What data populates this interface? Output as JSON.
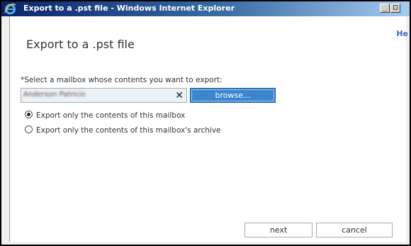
{
  "window": {
    "title": "Export to a .pst file - Windows Internet Explorer",
    "minimize_glyph": "_",
    "maximize_glyph": "□"
  },
  "header": {
    "help_link": "He"
  },
  "page": {
    "title": "Export to a .pst file"
  },
  "form": {
    "mailbox_prompt": "*Select a mailbox whose contents you want to export:",
    "mailbox_value": "Anderson Patricio",
    "clear_glyph": "✕",
    "browse_label": "browse...",
    "options": [
      {
        "label": "Export only the contents of this mailbox",
        "selected": true
      },
      {
        "label": "Export only the contents of this mailbox's archive",
        "selected": false
      }
    ]
  },
  "footer": {
    "next_label": "next",
    "cancel_label": "cancel"
  },
  "colors": {
    "accent": "#3b86cf",
    "titlebar": "#0a246a"
  }
}
